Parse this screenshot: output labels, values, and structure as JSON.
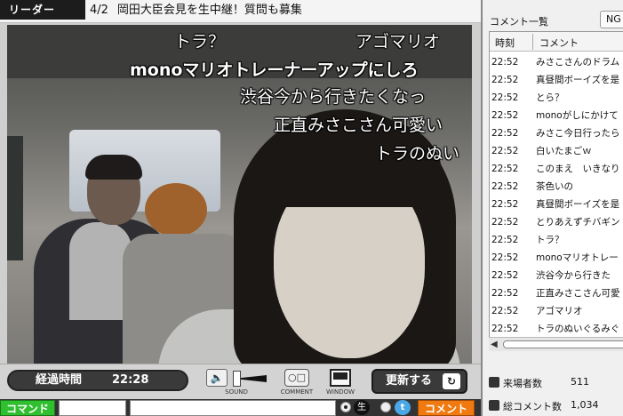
{
  "player": {
    "leader_label": "リーダー",
    "notice_number": "4/2",
    "notice_text": "岡田大臣会見を生中継！質問も募集",
    "overlay_comments": [
      "トラ？",
      "アゴマリオ",
      "monoマリオトレーナーアップにしろ",
      "渋谷今から行きたくなっ",
      "正直みさこさん可愛い",
      "トラのぬい"
    ],
    "elapsed_label": "経過時間",
    "elapsed_time": "22:28",
    "sound_label": "SOUND",
    "comment_label": "COMMENT",
    "window_label": "WINDOW",
    "refresh_label": "更新する",
    "command_label": "コマンド",
    "live_label": "生",
    "twitter_label": "t",
    "submit_label": "コメント"
  },
  "panel": {
    "title": "コメント一覧",
    "ng_label": "NG",
    "columns": {
      "time": "時刻",
      "comment": "コメント"
    },
    "rows": [
      {
        "time": "22:52",
        "comment": "みさこさんのドラム"
      },
      {
        "time": "22:52",
        "comment": "真昼間ボーイズを是"
      },
      {
        "time": "22:52",
        "comment": "とら？"
      },
      {
        "time": "22:52",
        "comment": "monoがしにかけて"
      },
      {
        "time": "22:52",
        "comment": "みさこ今日行ったら"
      },
      {
        "time": "22:52",
        "comment": "白いたまごｗ"
      },
      {
        "time": "22:52",
        "comment": "このまえ　いきなり"
      },
      {
        "time": "22:52",
        "comment": "茶色いの"
      },
      {
        "time": "22:52",
        "comment": "真昼間ボーイズを是"
      },
      {
        "time": "22:52",
        "comment": "とりあえずチバギン"
      },
      {
        "time": "22:52",
        "comment": "トラ？"
      },
      {
        "time": "22:52",
        "comment": "monoマリオトレー"
      },
      {
        "time": "22:52",
        "comment": "渋谷今から行きた"
      },
      {
        "time": "22:52",
        "comment": "正直みさこさん可愛"
      },
      {
        "time": "22:52",
        "comment": "アゴマリオ"
      },
      {
        "time": "22:52",
        "comment": "トラのぬいぐるみぐ"
      }
    ],
    "stats": [
      {
        "label": "来場者数",
        "value": "511"
      },
      {
        "label": "総コメント数",
        "value": "1,034"
      }
    ]
  }
}
